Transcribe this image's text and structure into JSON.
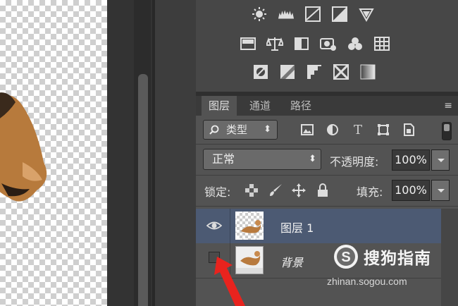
{
  "layers_panel": {
    "tabs": [
      "图层",
      "通道",
      "路径"
    ],
    "menu_glyph": "≡",
    "filter_label": "类型",
    "filter_arrows": "⬍",
    "filter_text_icon": "T",
    "blend_mode": "正常",
    "opacity_label": "不透明度:",
    "opacity_value": "100%",
    "lock_label": "锁定:",
    "fill_label": "填充:",
    "fill_value": "100%",
    "layers": [
      {
        "name": "图层 1",
        "visible": true,
        "selected": true
      },
      {
        "name": "背景",
        "visible": false,
        "selected": false
      }
    ]
  },
  "watermark": {
    "brand_text": "搜狗指南",
    "url": "zhinan.sogou.com"
  },
  "colors": {
    "panel_bg": "#535353",
    "selected_layer": "#4c5a73",
    "arrow": "#e8231e"
  }
}
